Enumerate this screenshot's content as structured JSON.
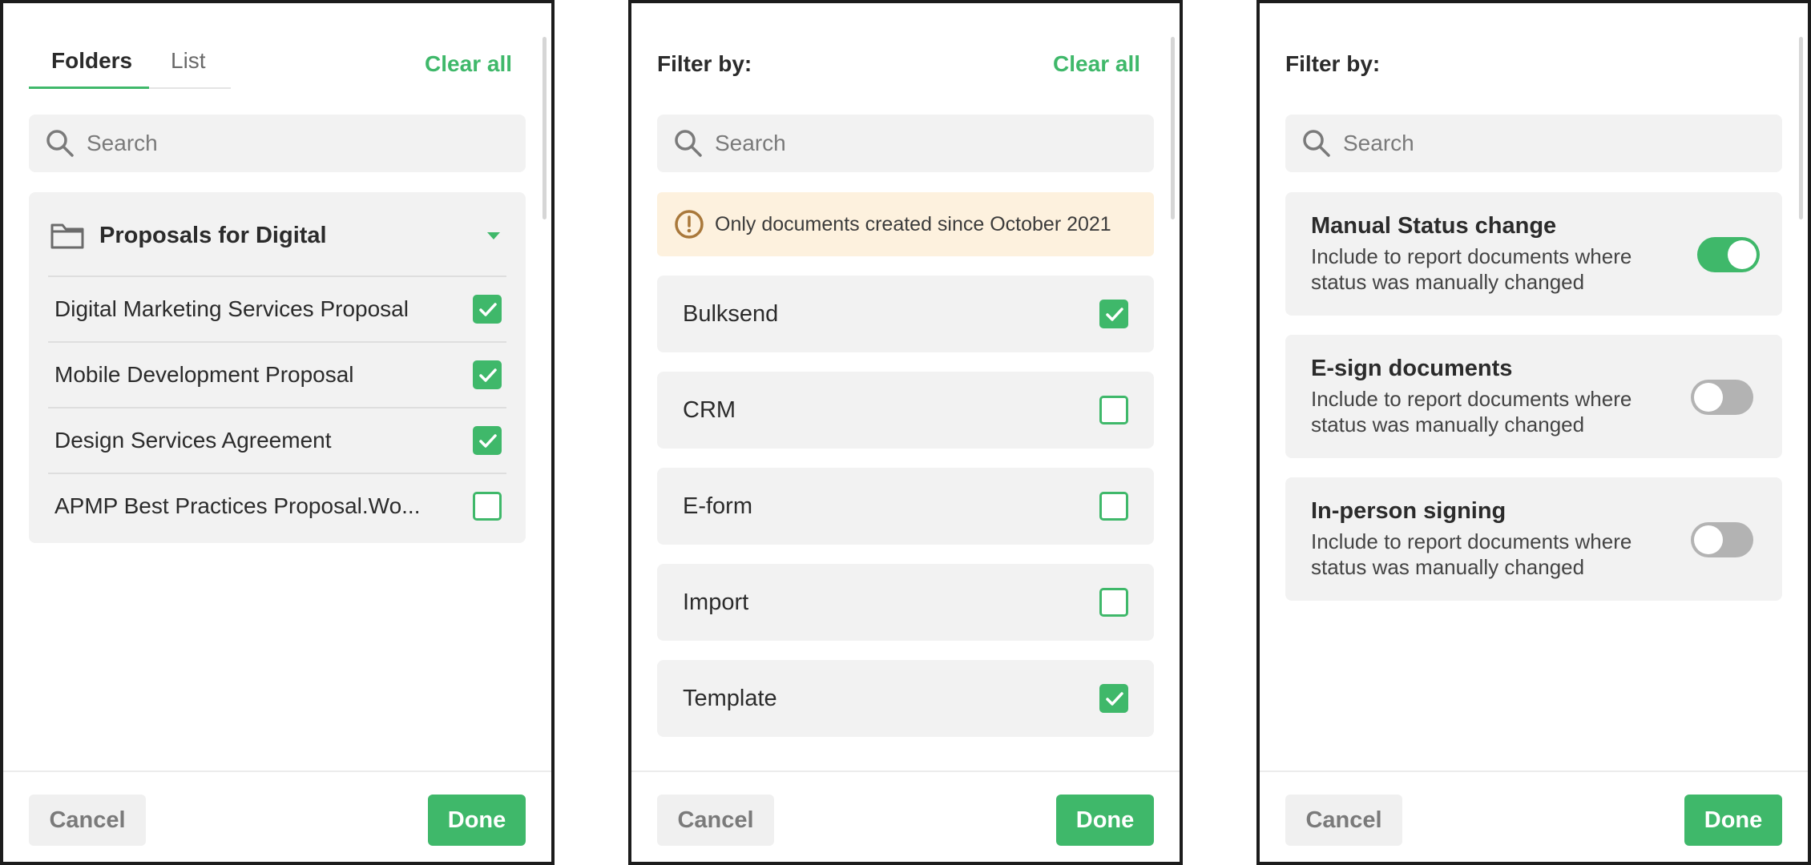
{
  "colors": {
    "accent": "#3fb86a",
    "notice_bg": "#fdf1de",
    "card_bg": "#f2f2f2",
    "warning": "#a9783a"
  },
  "panel1": {
    "tabs": [
      {
        "label": "Folders",
        "active": true
      },
      {
        "label": "List",
        "active": false
      }
    ],
    "clear_all": "Clear all",
    "search_placeholder": "Search",
    "folder": {
      "icon": "folder-icon",
      "title": "Proposals for Digital",
      "expanded": true,
      "items": [
        {
          "label": "Digital Marketing Services Proposal",
          "checked": true
        },
        {
          "label": "Mobile Development Proposal",
          "checked": true
        },
        {
          "label": "Design Services Agreement",
          "checked": true
        },
        {
          "label": "APMP Best Practices Proposal.Wo...",
          "checked": false
        }
      ]
    },
    "cancel": "Cancel",
    "done": "Done"
  },
  "panel2": {
    "title": "Filter by:",
    "clear_all": "Clear all",
    "search_placeholder": "Search",
    "notice": {
      "icon": "warning-icon",
      "text": "Only documents created since October 2021"
    },
    "options": [
      {
        "label": "Bulksend",
        "checked": true
      },
      {
        "label": "CRM",
        "checked": false
      },
      {
        "label": "E-form",
        "checked": false
      },
      {
        "label": "Import",
        "checked": false
      },
      {
        "label": "Template",
        "checked": true
      }
    ],
    "cancel": "Cancel",
    "done": "Done"
  },
  "panel3": {
    "title": "Filter by:",
    "search_placeholder": "Search",
    "toggles": [
      {
        "title": "Manual Status change",
        "description": "Include to report documents  where status was manually changed",
        "on": true
      },
      {
        "title": "E-sign documents",
        "description": "Include to report documents  where status was manually changed",
        "on": false
      },
      {
        "title": "In-person signing",
        "description": "Include to report documents  where status was manually changed",
        "on": false
      }
    ],
    "cancel": "Cancel",
    "done": "Done"
  }
}
